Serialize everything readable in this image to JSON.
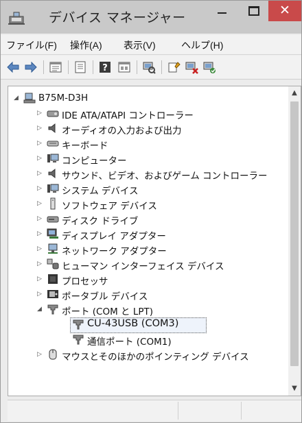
{
  "window": {
    "title": "デバイス マネージャー",
    "close_glyph": "✕"
  },
  "menu": [
    {
      "label": "ファイル(F)"
    },
    {
      "label": "操作(A)"
    },
    {
      "label": "表示(V)"
    },
    {
      "label": "ヘルプ(H)"
    }
  ],
  "tree": {
    "root": {
      "label": "B75M-D3H",
      "expanded": true
    },
    "items": [
      {
        "label": "IDE ATA/ATAPI コントローラー",
        "icon": "ide-controller-icon"
      },
      {
        "label": "オーディオの入力および出力",
        "icon": "speaker-icon"
      },
      {
        "label": "キーボード",
        "icon": "keyboard-icon"
      },
      {
        "label": "コンピューター",
        "icon": "computer-icon"
      },
      {
        "label": "サウンド、ビデオ、およびゲーム コントローラー",
        "icon": "sound-icon"
      },
      {
        "label": "システム デバイス",
        "icon": "system-device-icon"
      },
      {
        "label": "ソフトウェア デバイス",
        "icon": "software-device-icon"
      },
      {
        "label": "ディスク ドライブ",
        "icon": "disk-drive-icon"
      },
      {
        "label": "ディスプレイ アダプター",
        "icon": "display-adapter-icon"
      },
      {
        "label": "ネットワーク アダプター",
        "icon": "network-adapter-icon"
      },
      {
        "label": "ヒューマン インターフェイス デバイス",
        "icon": "hid-icon"
      },
      {
        "label": "プロセッサ",
        "icon": "processor-icon"
      },
      {
        "label": "ポータブル デバイス",
        "icon": "portable-device-icon"
      },
      {
        "label": "ポート (COM と LPT)",
        "icon": "port-icon",
        "expanded": true,
        "children": [
          {
            "label": "CU-43USB (COM3)",
            "icon": "port-icon",
            "selected": true
          },
          {
            "label": "通信ポート (COM1)",
            "icon": "port-icon"
          }
        ]
      },
      {
        "label": "マウスとそのほかのポインティング デバイス",
        "icon": "mouse-icon"
      }
    ]
  },
  "colors": {
    "close": "#c94a4a",
    "titlebar": "#c9c9c9"
  }
}
